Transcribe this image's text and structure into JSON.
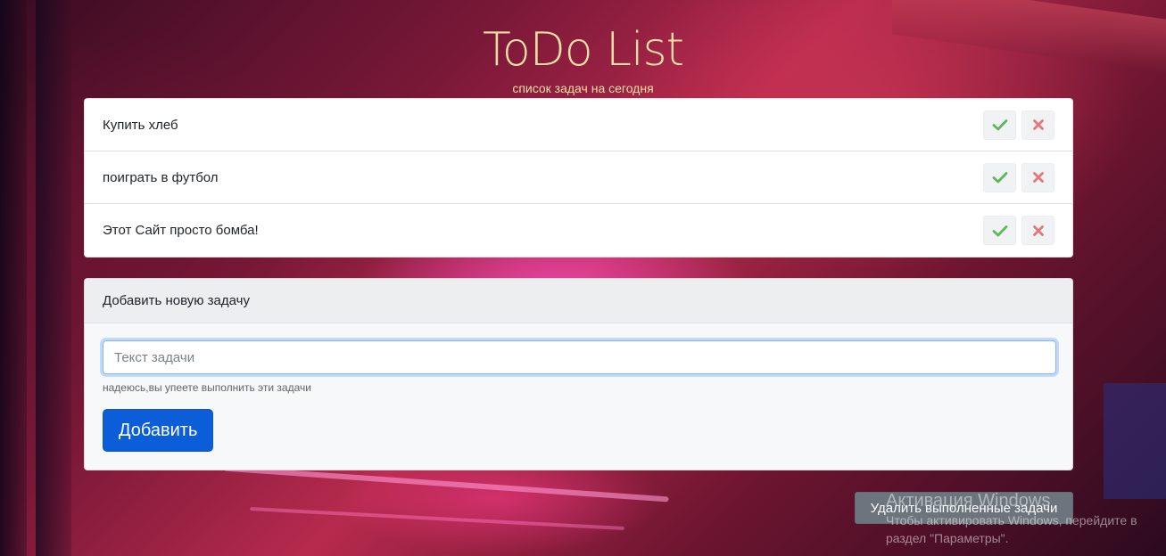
{
  "header": {
    "title": "ToDo List",
    "subtitle": "список задач на сегодня"
  },
  "tasks": [
    {
      "text": "Купить хлеб"
    },
    {
      "text": "поиграть в футбол"
    },
    {
      "text": "Этот Сайт просто бомба!"
    }
  ],
  "task_actions": {
    "complete_icon": "check-icon",
    "delete_icon": "close-icon",
    "complete_color": "#5cb85c",
    "delete_color": "#e37878"
  },
  "add_form": {
    "header": "Добавить новую задачу",
    "input_placeholder": "Текст задачи",
    "input_value": "",
    "help_text": "надеюсь,вы упеете выполнить эти задачи",
    "submit_label": "Добавить"
  },
  "footer": {
    "delete_completed_label": "Удалить выполненные задачи"
  },
  "windows_activation": {
    "title": "Активация Windows",
    "line1": "Чтобы активировать Windows, перейдите в",
    "line2": "раздел \"Параметры\"."
  },
  "colors": {
    "title": "#f2dfa6",
    "primary": "#0b5ed7",
    "secondary": "#6c757d"
  }
}
